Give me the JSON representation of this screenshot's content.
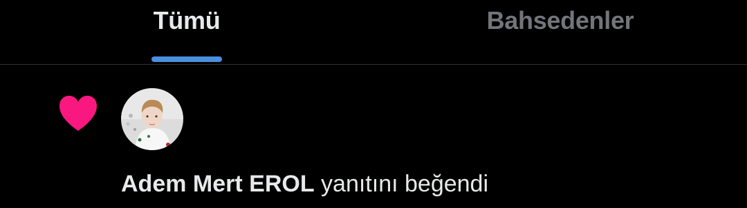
{
  "tabs": [
    {
      "label": "Tümü",
      "active": true
    },
    {
      "label": "Bahsedenler",
      "active": false
    }
  ],
  "colors": {
    "accent": "#1d9bf0",
    "indicator": "#4a8fe0",
    "heart": "#f91880",
    "text_primary": "#e7e9ea",
    "text_secondary": "#71767b",
    "background": "#000000"
  },
  "notification": {
    "icon": "heart-icon",
    "avatar_alt": "avatar",
    "user_name": "Adem Mert EROL",
    "action_text": "yanıtını beğendi"
  }
}
